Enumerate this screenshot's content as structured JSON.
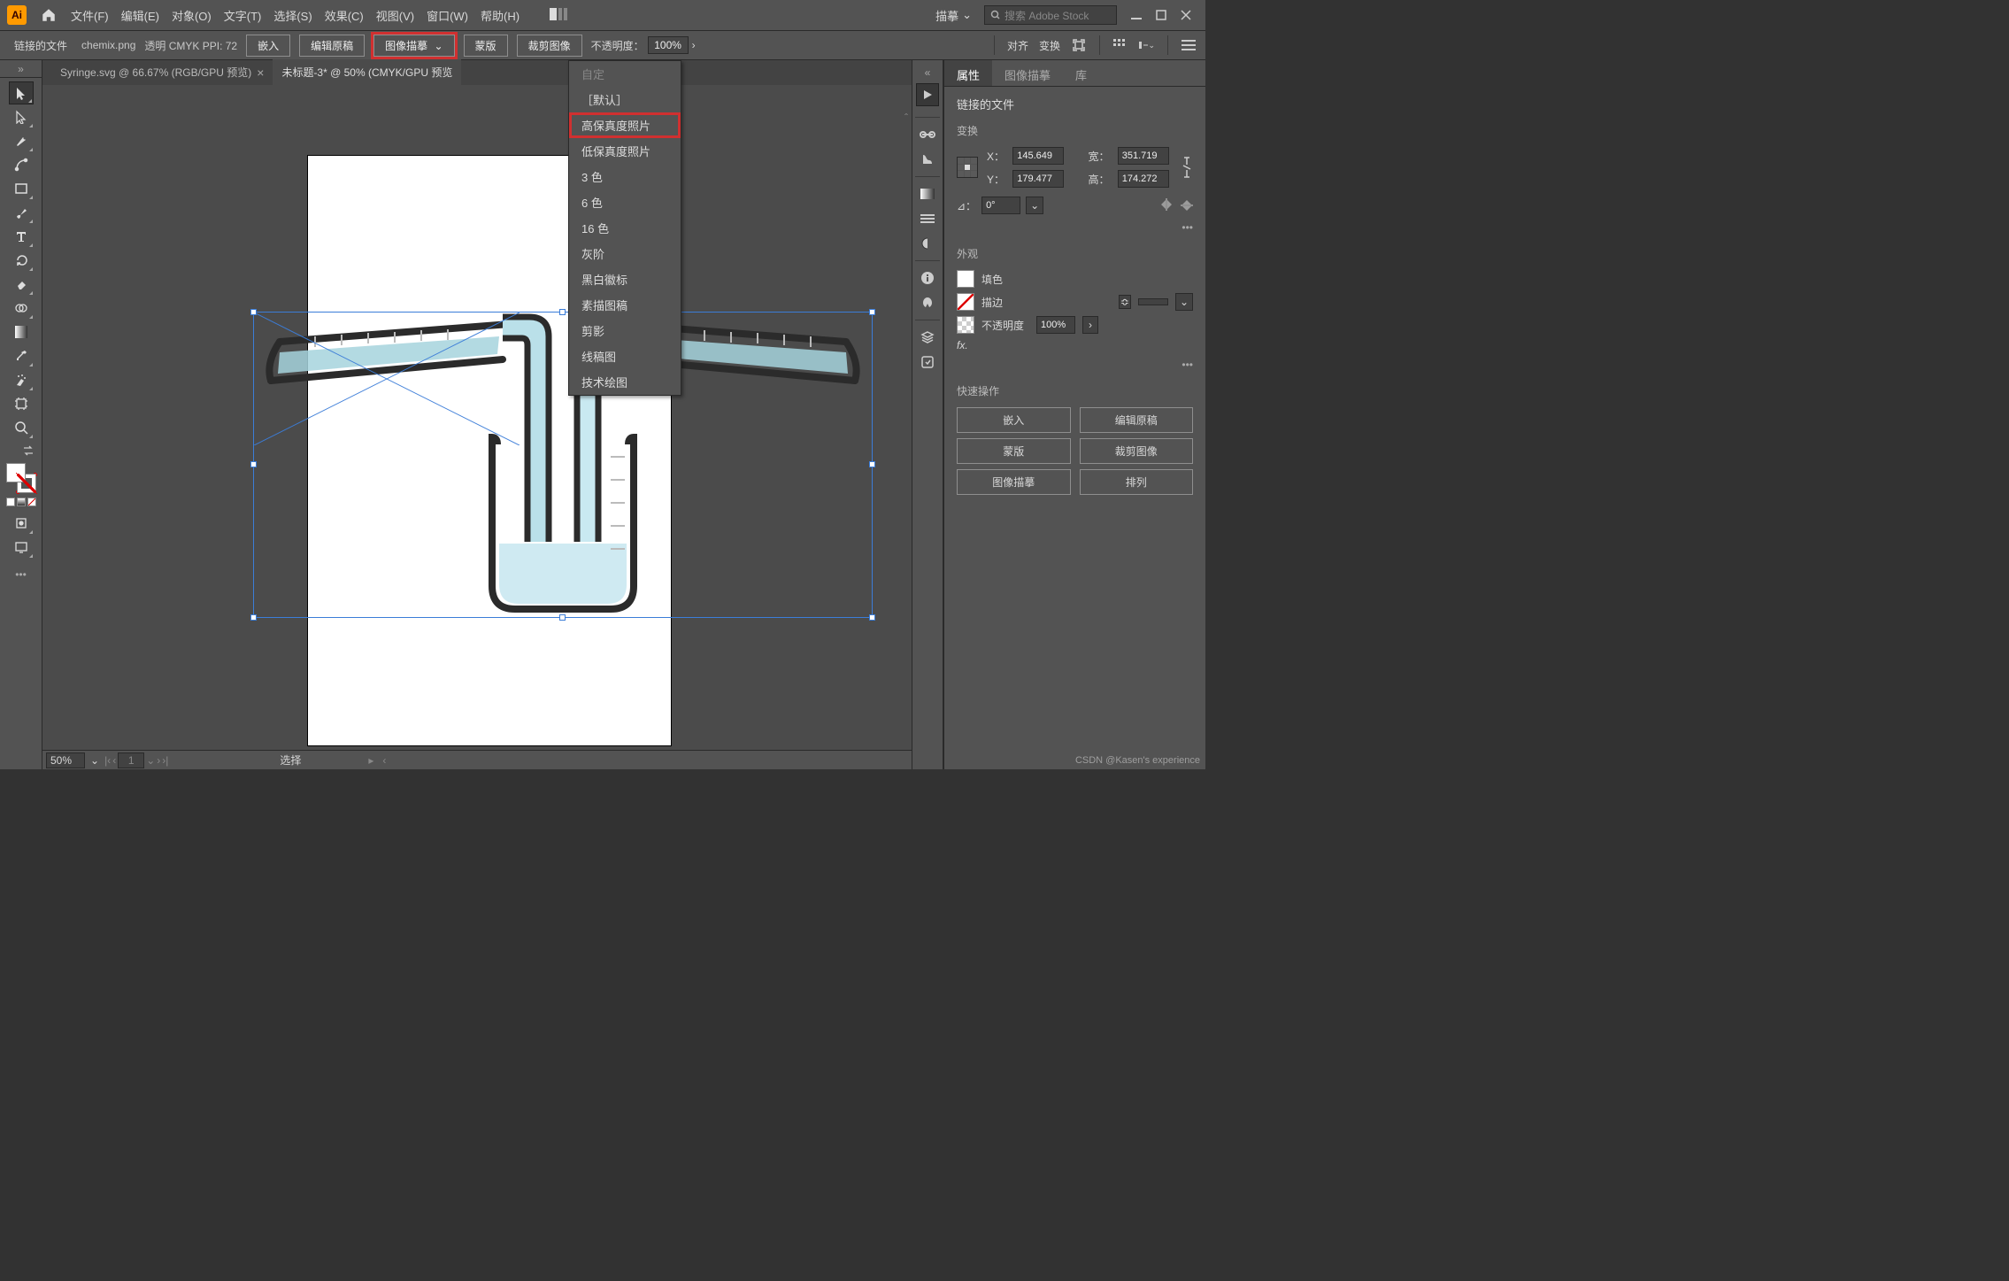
{
  "menu": {
    "items": [
      "文件(F)",
      "编辑(E)",
      "对象(O)",
      "文字(T)",
      "选择(S)",
      "效果(C)",
      "视图(V)",
      "窗口(W)",
      "帮助(H)"
    ]
  },
  "top": {
    "essentials": "描摹",
    "search_ph": "搜索 Adobe Stock"
  },
  "control": {
    "section": "链接的文件",
    "file": "chemix.png",
    "mode": "透明 CMYK  PPI: 72",
    "embed": "嵌入",
    "editorig": "编辑原稿",
    "trace": "图像描摹",
    "mask": "蒙版",
    "crop": "裁剪图像",
    "opacity_lbl": "不透明度：",
    "opacity_val": "100%",
    "align": "对齐",
    "transform": "变换"
  },
  "tabs": {
    "t1": "Syringe.svg @ 66.67% (RGB/GPU 预览)",
    "t2": "未标题-3* @ 50% (CMYK/GPU 预览"
  },
  "dd": {
    "custom": "自定",
    "default": "［默认］",
    "hi": "高保真度照片",
    "lo": "低保真度照片",
    "c3": "3 色",
    "c6": "6 色",
    "c16": "16 色",
    "gray": "灰阶",
    "bw": "黑白徽标",
    "sketch": "素描图稿",
    "sil": "剪影",
    "lineart": "线稿图",
    "tech": "技术绘图"
  },
  "prop": {
    "tab1": "属性",
    "tab2": "图像描摹",
    "tab3": "库",
    "linked": "链接的文件",
    "transform": "变换",
    "x_lbl": "X：",
    "x": "145.649 ",
    "w_lbl": "宽：",
    "w": "351.719 ",
    "y_lbl": "Y：",
    "y": "179.477 ",
    "h_lbl": "高：",
    "h": "174.272 ",
    "angle_lbl": "⊿：",
    "angle": "0°",
    "more": "•••",
    "appearance": "外观",
    "fill": "填色",
    "stroke": "描边",
    "opacity_lbl": "不透明度",
    "opacity": "100%",
    "fx": "fx.",
    "quick": "快速操作",
    "b_embed": "嵌入",
    "b_edit": "编辑原稿",
    "b_mask": "蒙版",
    "b_crop": "裁剪图像",
    "b_trace": "图像描摹",
    "b_arr": "排列"
  },
  "status": {
    "zoom": "50%",
    "art": "1",
    "sel": "选择"
  },
  "watermark": "CSDN @Kasen's experience"
}
